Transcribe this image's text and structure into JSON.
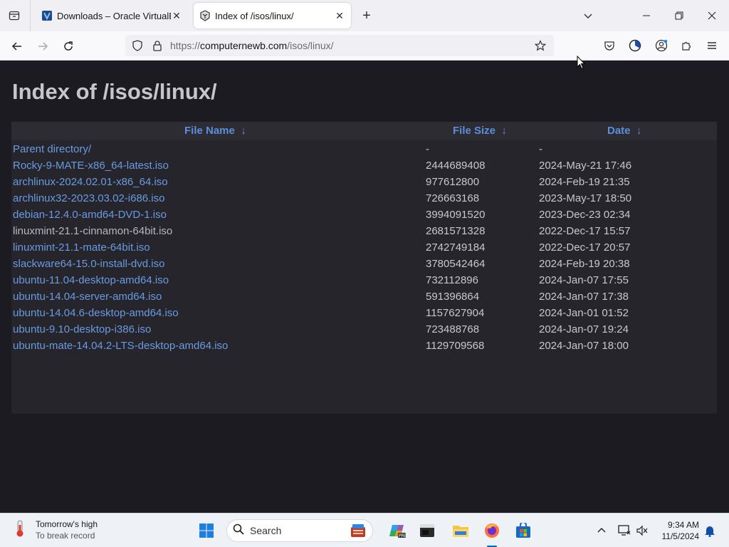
{
  "browser": {
    "tabs": [
      {
        "title": "Downloads – Oracle VirtualBox",
        "active": false,
        "favicon": "virtualbox-icon"
      },
      {
        "title": "Index of /isos/linux/",
        "active": true,
        "favicon": "site-favicon-icon"
      }
    ],
    "url": {
      "scheme": "https://",
      "host": "computernewb.com",
      "path": "/isos/linux/"
    }
  },
  "page": {
    "title": "Index of /isos/linux/",
    "columns": [
      {
        "label": "File Name",
        "sort": "↓"
      },
      {
        "label": "File Size",
        "sort": "↓"
      },
      {
        "label": "Date",
        "sort": "↓"
      }
    ],
    "rows": [
      {
        "name": "Parent directory/",
        "size": "-",
        "date": "-",
        "visited": false
      },
      {
        "name": "Rocky-9-MATE-x86_64-latest.iso",
        "size": "2444689408",
        "date": "2024-May-21 17:46",
        "visited": false
      },
      {
        "name": "archlinux-2024.02.01-x86_64.iso",
        "size": "977612800",
        "date": "2024-Feb-19 21:35",
        "visited": false
      },
      {
        "name": "archlinux32-2023.03.02-i686.iso",
        "size": "726663168",
        "date": "2023-May-17 18:50",
        "visited": false
      },
      {
        "name": "debian-12.4.0-amd64-DVD-1.iso",
        "size": "3994091520",
        "date": "2023-Dec-23 02:34",
        "visited": false
      },
      {
        "name": "linuxmint-21.1-cinnamon-64bit.iso",
        "size": "2681571328",
        "date": "2022-Dec-17 15:57",
        "visited": true
      },
      {
        "name": "linuxmint-21.1-mate-64bit.iso",
        "size": "2742749184",
        "date": "2022-Dec-17 20:57",
        "visited": false
      },
      {
        "name": "slackware64-15.0-install-dvd.iso",
        "size": "3780542464",
        "date": "2024-Feb-19 20:38",
        "visited": false
      },
      {
        "name": "ubuntu-11.04-desktop-amd64.iso",
        "size": "732112896",
        "date": "2024-Jan-07 17:55",
        "visited": false
      },
      {
        "name": "ubuntu-14.04-server-amd64.iso",
        "size": "591396864",
        "date": "2024-Jan-07 17:38",
        "visited": false
      },
      {
        "name": "ubuntu-14.04.6-desktop-amd64.iso",
        "size": "1157627904",
        "date": "2024-Jan-01 01:52",
        "visited": false
      },
      {
        "name": "ubuntu-9.10-desktop-i386.iso",
        "size": "723488768",
        "date": "2024-Jan-07 19:24",
        "visited": false
      },
      {
        "name": "ubuntu-mate-14.04.2-LTS-desktop-amd64.iso",
        "size": "1129709568",
        "date": "2024-Jan-07 18:00",
        "visited": false
      }
    ]
  },
  "taskbar": {
    "weather": {
      "line1": "Tomorrow's high",
      "line2": "To break record"
    },
    "search_label": "Search",
    "time": "9:34 AM",
    "date": "11/5/2024"
  },
  "colors": {
    "link": "#6a9ae0",
    "visited": "#b7b7bc",
    "heading": "#5d8edb",
    "page_bg": "#1c1b22",
    "table_bg": "#26252c"
  }
}
